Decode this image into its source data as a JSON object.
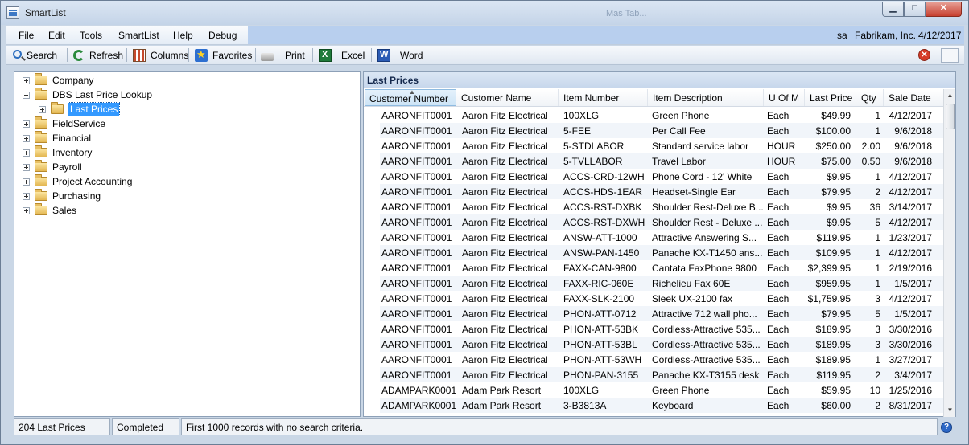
{
  "window": {
    "title": "SmartList",
    "ghost_title": "Mas Tab..."
  },
  "menu": {
    "items": [
      "File",
      "Edit",
      "Tools",
      "SmartList",
      "Help",
      "Debug"
    ],
    "user": "sa",
    "company": "Fabrikam, Inc.",
    "date": "4/12/2017"
  },
  "toolbar": {
    "search": "Search",
    "refresh": "Refresh",
    "columns": "Columns",
    "favorites": "Favorites",
    "print": "Print",
    "excel": "Excel",
    "word": "Word"
  },
  "tree": {
    "items": [
      {
        "label": "Company"
      },
      {
        "label": "DBS Last Price Lookup"
      },
      {
        "label": "Last Prices"
      },
      {
        "label": "FieldService"
      },
      {
        "label": "Financial"
      },
      {
        "label": "Inventory"
      },
      {
        "label": "Payroll"
      },
      {
        "label": "Project Accounting"
      },
      {
        "label": "Purchasing"
      },
      {
        "label": "Sales"
      }
    ]
  },
  "list": {
    "title": "Last Prices",
    "columns": [
      "Customer Number",
      "Customer Name",
      "Item Number",
      "Item Description",
      "U Of M",
      "Last Price",
      "Qty",
      "Sale Date"
    ],
    "rows": [
      [
        "AARONFIT0001",
        "Aaron Fitz Electrical",
        "100XLG",
        "Green Phone",
        "Each",
        "$49.99",
        "1",
        "4/12/2017"
      ],
      [
        "AARONFIT0001",
        "Aaron Fitz Electrical",
        "5-FEE",
        "Per Call Fee",
        "Each",
        "$100.00",
        "1",
        "9/6/2018"
      ],
      [
        "AARONFIT0001",
        "Aaron Fitz Electrical",
        "5-STDLABOR",
        "Standard service labor",
        "HOUR",
        "$250.00",
        "2.00",
        "9/6/2018"
      ],
      [
        "AARONFIT0001",
        "Aaron Fitz Electrical",
        "5-TVLLABOR",
        "Travel Labor",
        "HOUR",
        "$75.00",
        "0.50",
        "9/6/2018"
      ],
      [
        "AARONFIT0001",
        "Aaron Fitz Electrical",
        "ACCS-CRD-12WH",
        "Phone Cord - 12' White",
        "Each",
        "$9.95",
        "1",
        "4/12/2017"
      ],
      [
        "AARONFIT0001",
        "Aaron Fitz Electrical",
        "ACCS-HDS-1EAR",
        "Headset-Single Ear",
        "Each",
        "$79.95",
        "2",
        "4/12/2017"
      ],
      [
        "AARONFIT0001",
        "Aaron Fitz Electrical",
        "ACCS-RST-DXBK",
        "Shoulder Rest-Deluxe B...",
        "Each",
        "$9.95",
        "36",
        "3/14/2017"
      ],
      [
        "AARONFIT0001",
        "Aaron Fitz Electrical",
        "ACCS-RST-DXWH",
        "Shoulder Rest - Deluxe ...",
        "Each",
        "$9.95",
        "5",
        "4/12/2017"
      ],
      [
        "AARONFIT0001",
        "Aaron Fitz Electrical",
        "ANSW-ATT-1000",
        "Attractive Answering S...",
        "Each",
        "$119.95",
        "1",
        "1/23/2017"
      ],
      [
        "AARONFIT0001",
        "Aaron Fitz Electrical",
        "ANSW-PAN-1450",
        "Panache KX-T1450 ans...",
        "Each",
        "$109.95",
        "1",
        "4/12/2017"
      ],
      [
        "AARONFIT0001",
        "Aaron Fitz Electrical",
        "FAXX-CAN-9800",
        "Cantata FaxPhone 9800",
        "Each",
        "$2,399.95",
        "1",
        "2/19/2016"
      ],
      [
        "AARONFIT0001",
        "Aaron Fitz Electrical",
        "FAXX-RIC-060E",
        "Richelieu Fax 60E",
        "Each",
        "$959.95",
        "1",
        "1/5/2017"
      ],
      [
        "AARONFIT0001",
        "Aaron Fitz Electrical",
        "FAXX-SLK-2100",
        "Sleek UX-2100 fax",
        "Each",
        "$1,759.95",
        "3",
        "4/12/2017"
      ],
      [
        "AARONFIT0001",
        "Aaron Fitz Electrical",
        "PHON-ATT-0712",
        "Attractive 712 wall pho...",
        "Each",
        "$79.95",
        "5",
        "1/5/2017"
      ],
      [
        "AARONFIT0001",
        "Aaron Fitz Electrical",
        "PHON-ATT-53BK",
        "Cordless-Attractive 535...",
        "Each",
        "$189.95",
        "3",
        "3/30/2016"
      ],
      [
        "AARONFIT0001",
        "Aaron Fitz Electrical",
        "PHON-ATT-53BL",
        "Cordless-Attractive 535...",
        "Each",
        "$189.95",
        "3",
        "3/30/2016"
      ],
      [
        "AARONFIT0001",
        "Aaron Fitz Electrical",
        "PHON-ATT-53WH",
        "Cordless-Attractive 535...",
        "Each",
        "$189.95",
        "1",
        "3/27/2017"
      ],
      [
        "AARONFIT0001",
        "Aaron Fitz Electrical",
        "PHON-PAN-3155",
        "Panache KX-T3155 desk",
        "Each",
        "$119.95",
        "2",
        "3/4/2017"
      ],
      [
        "ADAMPARK0001",
        "Adam Park Resort",
        "100XLG",
        "Green Phone",
        "Each",
        "$59.95",
        "10",
        "1/25/2016"
      ],
      [
        "ADAMPARK0001",
        "Adam Park Resort",
        "3-B3813A",
        "Keyboard",
        "Each",
        "$60.00",
        "2",
        "8/31/2017"
      ]
    ]
  },
  "status": {
    "count": "204 Last Prices",
    "state": "Completed",
    "message": "First 1000 records with no search criteria."
  }
}
